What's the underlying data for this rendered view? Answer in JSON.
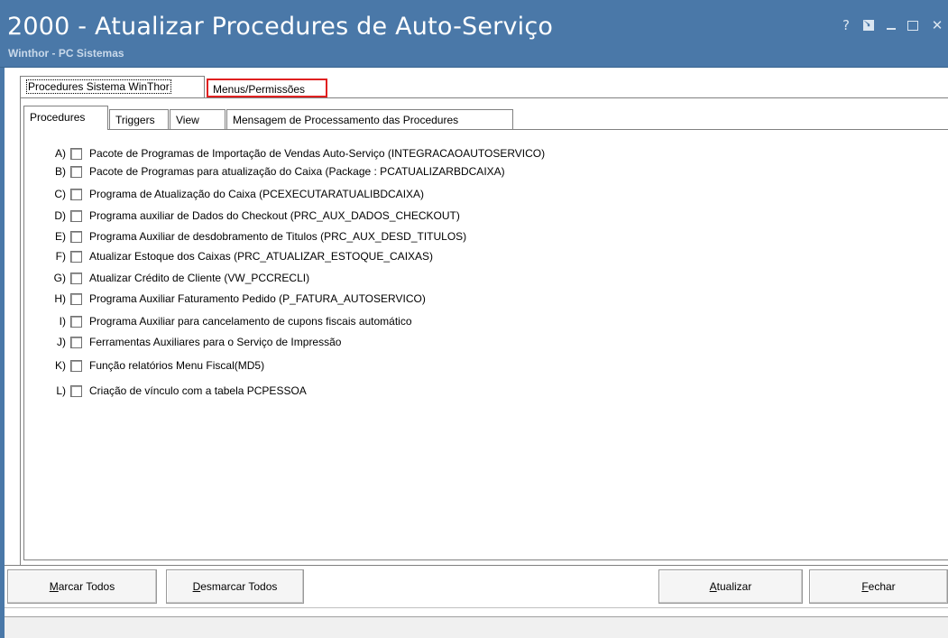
{
  "window": {
    "title": "2000 - Atualizar Procedures de Auto-Serviço",
    "subtitle": "Winthor - PC Sistemas",
    "controls": {
      "help": "?",
      "close": "✕"
    }
  },
  "outer_tabs": [
    {
      "label": "Procedures Sistema WinThor",
      "active": true
    },
    {
      "label": "Menus/Permissões",
      "active": false,
      "highlighted": true
    }
  ],
  "inner_tabs": [
    {
      "label": "Procedures",
      "active": true
    },
    {
      "label": "Triggers",
      "active": false
    },
    {
      "label": "View",
      "active": false
    },
    {
      "label": "Mensagem de Processamento das Procedures",
      "active": false
    }
  ],
  "procedures": [
    {
      "letter": "A)",
      "label": "Pacote de Programas de Importação de Vendas Auto-Serviço (INTEGRACAOAUTOSERVICO)",
      "checked": false
    },
    {
      "letter": "B)",
      "label": "Pacote de Programas para atualização do Caixa (Package : PCATUALIZARBDCAIXA)",
      "checked": false
    },
    {
      "letter": "C)",
      "label": "Programa de Atualização do Caixa  (PCEXECUTARATUALIBDCAIXA)",
      "checked": false
    },
    {
      "letter": "D)",
      "label": "Programa auxiliar de Dados do Checkout (PRC_AUX_DADOS_CHECKOUT)",
      "checked": false
    },
    {
      "letter": "E)",
      "label": "Programa Auxiliar de desdobramento de Titulos (PRC_AUX_DESD_TITULOS)",
      "checked": false
    },
    {
      "letter": "F)",
      "label": "Atualizar Estoque dos Caixas (PRC_ATUALIZAR_ESTOQUE_CAIXAS)",
      "checked": false
    },
    {
      "letter": "G)",
      "label": "Atualizar Crédito de Cliente (VW_PCCRECLI)",
      "checked": false
    },
    {
      "letter": "H)",
      "label": "Programa Auxiliar Faturamento Pedido  (P_FATURA_AUTOSERVICO)",
      "checked": false
    },
    {
      "letter": "I)",
      "label": "Programa Auxiliar para cancelamento de cupons fiscais automático",
      "checked": false
    },
    {
      "letter": "J)",
      "label": "Ferramentas Auxiliares para o Serviço de Impressão",
      "checked": false
    },
    {
      "letter": "K)",
      "label": "Função relatórios Menu Fiscal(MD5)",
      "checked": false
    },
    {
      "letter": "L)",
      "label": "Criação de vínculo com a tabela PCPESSOA",
      "checked": false
    }
  ],
  "buttons": {
    "marcar": {
      "mnemonic": "M",
      "rest": "arcar Todos"
    },
    "desmarcar": {
      "mnemonic": "D",
      "rest": "esmarcar Todos"
    },
    "atualizar": {
      "mnemonic": "A",
      "rest": "tualizar"
    },
    "fechar": {
      "mnemonic": "F",
      "rest": "echar"
    }
  },
  "colors": {
    "titlebar": "#4a78a8",
    "highlight_border": "#e02020"
  }
}
